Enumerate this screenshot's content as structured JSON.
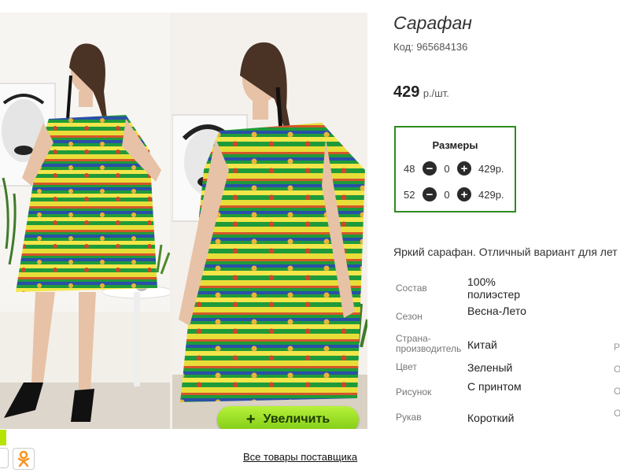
{
  "product": {
    "title": "Сарафан",
    "code_label": "Код: 965684136",
    "price": "429",
    "price_unit": "р./шт.",
    "description": "Яркий сарафан. Отличный вариант для лет"
  },
  "gallery": {
    "zoom_label": "Увеличить",
    "zoom_icon": "+",
    "all_products_link": "Все товары поставщика"
  },
  "sizes": {
    "title": "Размеры",
    "rows": [
      {
        "size": "48",
        "qty": "0",
        "price": "429р."
      },
      {
        "size": "52",
        "qty": "0",
        "price": "429р."
      }
    ]
  },
  "specs": [
    {
      "label": "Состав",
      "value": "100% полиэстер"
    },
    {
      "label": "Сезон",
      "value": "Весна-Лето"
    },
    {
      "label": "Страна-производитель",
      "value": "Китай"
    },
    {
      "label": "Цвет",
      "value": "Зеленый"
    },
    {
      "label": "Рисунок",
      "value": "С принтом"
    },
    {
      "label": "Рукав",
      "value": "Короткий"
    }
  ],
  "edge_letters": [
    "Р",
    "О",
    "О",
    "О"
  ],
  "colors": {
    "accent_border": "#2e8b1e",
    "zoom_button": "#9be02a",
    "dress_green": "#1f9a3a",
    "dress_yellow": "#e8de3a"
  }
}
